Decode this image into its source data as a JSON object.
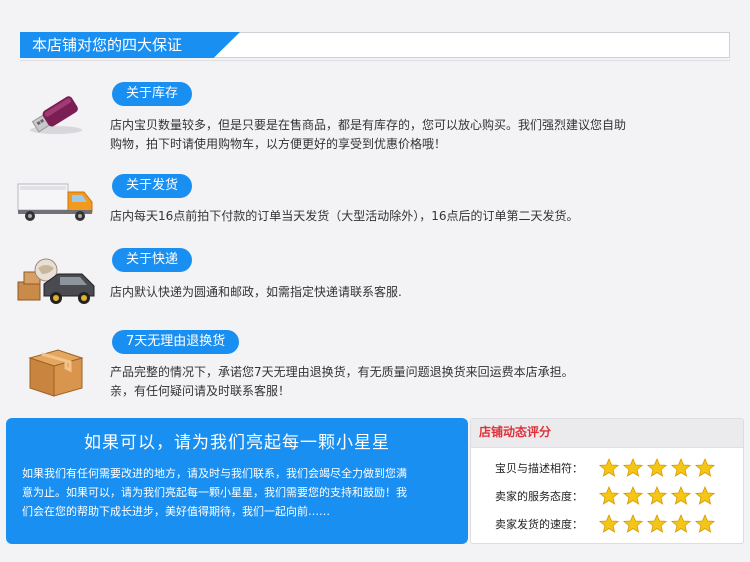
{
  "header": {
    "title": "本店铺对您的四大保证"
  },
  "guarantees": [
    {
      "badge": "关于库存",
      "icon": "usb-drive-icon",
      "lines": [
        "店内宝贝数量较多，但是只要是在售商品，都是有库存的，您可以放心购买。我们强烈建议您自助",
        "购物，拍下时请使用购物车，以方便更好的享受到优惠价格哦！"
      ]
    },
    {
      "badge": "关于发货",
      "icon": "delivery-truck-icon",
      "lines": [
        "店内每天16点前拍下付款的订单当天发货（大型活动除外），16点后的订单第二天发货。"
      ]
    },
    {
      "badge": "关于快递",
      "icon": "courier-car-icon",
      "lines": [
        "店内默认快递为圆通和邮政，如需指定快递请联系客服."
      ]
    },
    {
      "badge": "7天无理由退换货",
      "icon": "package-box-icon",
      "lines": [
        "产品完整的情况下，承诺您7天无理由退换货，有无质量问题退换货来回运费本店承担。",
        "亲，有任何疑问请及时联系客服！"
      ]
    }
  ],
  "star_request": {
    "title": "如果可以，请为我们亮起每一颗小星星",
    "lines": [
      "如果我们有任何需要改进的地方，请及时与我们联系，我们会竭尽全力做到您满",
      "意为止。如果可以，请为我们亮起每一颗小星星，我们需要您的支持和鼓励！我",
      "们会在您的帮助下成长进步，美好值得期待，我们一起向前……"
    ]
  },
  "store_rating": {
    "title": "店铺动态评分",
    "rows": [
      {
        "label": "宝贝与描述相符：",
        "stars": 5
      },
      {
        "label": "卖家的服务态度：",
        "stars": 5
      },
      {
        "label": "卖家发货的速度：",
        "stars": 5
      }
    ],
    "star_color": "#f5c518"
  },
  "colors": {
    "accent": "#1a8ff2",
    "rating_title": "#e0303a"
  }
}
